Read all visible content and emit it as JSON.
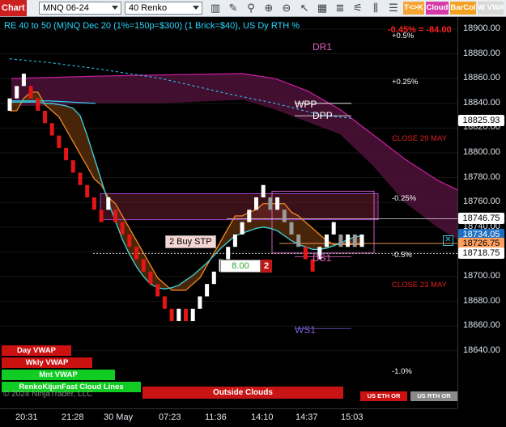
{
  "toolbar": {
    "chart_tab": "Chart",
    "instrument": "MNQ 06-24",
    "bar_type": "40 Renko",
    "icons": [
      "bar-chart-icon",
      "pencil-icon",
      "search-icon",
      "zoom-in-icon",
      "zoom-out-icon",
      "drawing-tools-icon",
      "grid-icon",
      "align-icon",
      "sliders-icon",
      "candles-icon",
      "properties-icon"
    ],
    "plugins": [
      {
        "label": "T<>K",
        "bg": "#f4a533",
        "color": "#ffffff"
      },
      {
        "label": "Cloud",
        "bg": "#d63aa7",
        "color": "#ffffff"
      },
      {
        "label": "BarCol",
        "bg": "#f1a11f",
        "color": "#ffffff"
      },
      {
        "label": "W VWAP",
        "bg": "#d8d8d8",
        "color": "#ffffff"
      }
    ]
  },
  "chart": {
    "title": "RE 40 to 50 (M)NQ Dec 20 (1%=150p=$300) (1 Brick=$40), US Dy RTH %",
    "pnl": "-0.45% = -84.00",
    "watermark": "© 2024 NinjaTrader, LLC",
    "level_labels": [
      {
        "text": "DR1",
        "price": 18882,
        "color": "#e060c0"
      },
      {
        "text": "WPP",
        "price": 18835,
        "color": "#ffffff"
      },
      {
        "text": "DPP",
        "price": 18826,
        "color": "#ffffff"
      },
      {
        "text": "DS1",
        "price": 18711,
        "color": "#e060c0"
      },
      {
        "text": "WS1",
        "price": 18653,
        "color": "#7a5cd6"
      }
    ],
    "pct_labels": [
      {
        "text": "+0.5%",
        "price": 18894,
        "color": "#ffffff"
      },
      {
        "text": "+0.25%",
        "price": 18857,
        "color": "#ffffff"
      },
      {
        "text": "CLOSE 29 MAY",
        "price": 18811,
        "color": "#e02020"
      },
      {
        "text": "-0.25%",
        "price": 18763,
        "color": "#ffffff"
      },
      {
        "text": "-0.5%",
        "price": 18717,
        "color": "#ffffff"
      },
      {
        "text": "CLOSE 23 MAY",
        "price": 18693,
        "color": "#e02020"
      },
      {
        "text": "-1.0%",
        "price": 18623,
        "color": "#ffffff"
      }
    ],
    "buy_stop_label": "2 Buy STP",
    "order_qty_value": "8.00",
    "order_count": "2",
    "vwap_buttons": [
      {
        "label": "Day VWAP",
        "bg": "#cc1111"
      },
      {
        "label": "Wkly VWAP",
        "bg": "#cc1111"
      },
      {
        "label": "Mnt VWAP",
        "bg": "#11cc22"
      },
      {
        "label": "RenkoKijunFast Cloud Lines",
        "bg": "#11cc22"
      }
    ],
    "outside_clouds_label": "Outside Clouds",
    "session_buttons": [
      {
        "label": "US ETH OR",
        "bg": "#cc1111"
      },
      {
        "label": "US RTH OR",
        "bg": "#8a8a8a"
      }
    ]
  },
  "price_axis": {
    "ticks": [
      18900,
      18880,
      18860,
      18840,
      18820,
      18800,
      18780,
      18760,
      18740,
      18720,
      18700,
      18680,
      18660,
      18640
    ],
    "tick_labels": [
      "18900.00",
      "18880.00",
      "18860.00",
      "18840.00",
      "18820.00",
      "18800.00",
      "18780.00",
      "18760.00",
      "18740.00",
      "18720.00",
      "18700.00",
      "18680.00",
      "18660.00",
      "18640.00"
    ],
    "markers": [
      {
        "text": "18825.93",
        "price": 18825.93,
        "bg": "#ffffff",
        "fg": "#000000"
      },
      {
        "text": "18746.75",
        "price": 18746.75,
        "bg": "#ffffff",
        "fg": "#000000"
      },
      {
        "text": "18734.05",
        "price": 18734.05,
        "bg": "#1e6fbf",
        "fg": "#ffffff"
      },
      {
        "text": "18726.75",
        "price": 18726.75,
        "bg": "#ffa060",
        "fg": "#000000"
      },
      {
        "text": "18718.75",
        "price": 18718.75,
        "bg": "#ffffff",
        "fg": "#000000"
      }
    ]
  },
  "time_axis": {
    "labels": [
      "20:31",
      "21:28",
      "30 May",
      "07:23",
      "11:36",
      "14:10",
      "14:37",
      "15:03"
    ]
  },
  "chart_data": {
    "type": "renko",
    "brick_size": 10,
    "bricks": [
      {
        "i": 0,
        "o": 18834,
        "c": 18844
      },
      {
        "i": 1,
        "o": 18844,
        "c": 18854
      },
      {
        "i": 2,
        "o": 18854,
        "c": 18864
      },
      {
        "i": 3,
        "o": 18854,
        "c": 18844
      },
      {
        "i": 4,
        "o": 18844,
        "c": 18834
      },
      {
        "i": 5,
        "o": 18834,
        "c": 18824
      },
      {
        "i": 6,
        "o": 18824,
        "c": 18814
      },
      {
        "i": 7,
        "o": 18814,
        "c": 18804
      },
      {
        "i": 8,
        "o": 18804,
        "c": 18794
      },
      {
        "i": 9,
        "o": 18794,
        "c": 18784
      },
      {
        "i": 10,
        "o": 18784,
        "c": 18774
      },
      {
        "i": 11,
        "o": 18774,
        "c": 18764
      },
      {
        "i": 12,
        "o": 18764,
        "c": 18754
      },
      {
        "i": 13,
        "o": 18754,
        "c": 18744
      },
      {
        "i": 14,
        "o": 18754,
        "c": 18764
      },
      {
        "i": 15,
        "o": 18754,
        "c": 18744
      },
      {
        "i": 16,
        "o": 18744,
        "c": 18734
      },
      {
        "i": 17,
        "o": 18734,
        "c": 18724
      },
      {
        "i": 18,
        "o": 18724,
        "c": 18714
      },
      {
        "i": 19,
        "o": 18714,
        "c": 18704
      },
      {
        "i": 20,
        "o": 18704,
        "c": 18694
      },
      {
        "i": 21,
        "o": 18694,
        "c": 18684
      },
      {
        "i": 22,
        "o": 18684,
        "c": 18674
      },
      {
        "i": 23,
        "o": 18674,
        "c": 18664
      },
      {
        "i": 24,
        "o": 18664,
        "c": 18674
      },
      {
        "i": 25,
        "o": 18674,
        "c": 18664
      },
      {
        "i": 26,
        "o": 18664,
        "c": 18674
      },
      {
        "i": 27,
        "o": 18674,
        "c": 18684
      },
      {
        "i": 28,
        "o": 18684,
        "c": 18694
      },
      {
        "i": 29,
        "o": 18694,
        "c": 18704
      },
      {
        "i": 30,
        "o": 18704,
        "c": 18714
      },
      {
        "i": 31,
        "o": 18714,
        "c": 18724
      },
      {
        "i": 32,
        "o": 18724,
        "c": 18734
      },
      {
        "i": 33,
        "o": 18734,
        "c": 18744
      },
      {
        "i": 34,
        "o": 18744,
        "c": 18754
      },
      {
        "i": 35,
        "o": 18754,
        "c": 18764
      },
      {
        "i": 36,
        "o": 18764,
        "c": 18774
      },
      {
        "i": 37,
        "o": 18764,
        "c": 18754
      },
      {
        "i": 38,
        "o": 18754,
        "c": 18764
      },
      {
        "i": 39,
        "o": 18754,
        "c": 18744
      },
      {
        "i": 40,
        "o": 18744,
        "c": 18734
      },
      {
        "i": 41,
        "o": 18734,
        "c": 18724
      },
      {
        "i": 42,
        "o": 18724,
        "c": 18714
      },
      {
        "i": 43,
        "o": 18714,
        "c": 18704
      },
      {
        "i": 44,
        "o": 18714,
        "c": 18724
      },
      {
        "i": 45,
        "o": 18724,
        "c": 18734
      },
      {
        "i": 46,
        "o": 18734,
        "c": 18744
      },
      {
        "i": 47,
        "o": 18734,
        "c": 18724
      },
      {
        "i": 48,
        "o": 18724,
        "c": 18734
      },
      {
        "i": 49,
        "o": 18734,
        "c": 18724
      },
      {
        "i": 50,
        "o": 18724,
        "c": 18734
      }
    ],
    "kijun_fast": [
      18834,
      18834,
      18844,
      18849,
      18849,
      18839,
      18834,
      18829,
      18819,
      18809,
      18799,
      18789,
      18779,
      18774,
      18764,
      18759,
      18749,
      18739,
      18729,
      18719,
      18709,
      18699,
      18694,
      18689,
      18689,
      18689,
      18694,
      18699,
      18709,
      18719,
      18729,
      18739,
      18749,
      18749,
      18752,
      18754,
      18759,
      18759,
      18759,
      18759,
      18752,
      18749,
      18744,
      18739,
      18734,
      18729,
      18726,
      18726,
      18726,
      18726,
      18726
    ],
    "kijun_slow": [
      18841,
      18841,
      18841,
      18841,
      18841,
      18840,
      18840,
      18839,
      18838,
      18836,
      18830,
      18814,
      18796,
      18778,
      18760,
      18745,
      18730,
      18718,
      18708,
      18700,
      18694,
      18691,
      18690,
      18691,
      18693,
      18697,
      18701,
      18706,
      18711,
      18717,
      18723,
      18728,
      18733,
      18735,
      18737,
      18739,
      18740,
      18739,
      18737,
      18733,
      18729,
      18726,
      18724,
      18722,
      18722,
      18723,
      18725,
      18727,
      18730,
      18732,
      18733
    ],
    "ylim": [
      18620,
      18910
    ]
  }
}
